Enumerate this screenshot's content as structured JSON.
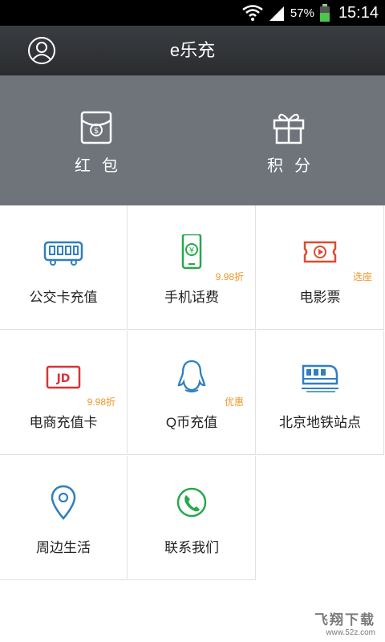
{
  "status_bar": {
    "battery": "57%",
    "time": "15:14"
  },
  "header": {
    "title": "e乐充"
  },
  "hero": [
    {
      "label": "红包"
    },
    {
      "label": "积分"
    }
  ],
  "tiles": [
    {
      "label": "公交卡充值",
      "badge": ""
    },
    {
      "label": "手机话费",
      "badge": "9.98折"
    },
    {
      "label": "电影票",
      "badge": "选座"
    },
    {
      "label": "电商充值卡",
      "badge": "9.98折",
      "icon_text": "JD"
    },
    {
      "label": "Q币充值",
      "badge": "优惠"
    },
    {
      "label": "北京地铁站点",
      "badge": ""
    },
    {
      "label": "周边生活",
      "badge": ""
    },
    {
      "label": "联系我们",
      "badge": ""
    }
  ],
  "watermark": {
    "line1": "飞翔下载",
    "line2": "www.52z.com"
  },
  "colors": {
    "blue": "#2f7fc1",
    "green": "#27a84a",
    "red": "#e04a2e",
    "jd_red": "#d6333a",
    "badge": "#f0962a",
    "hero_bg": "#6f747b"
  }
}
